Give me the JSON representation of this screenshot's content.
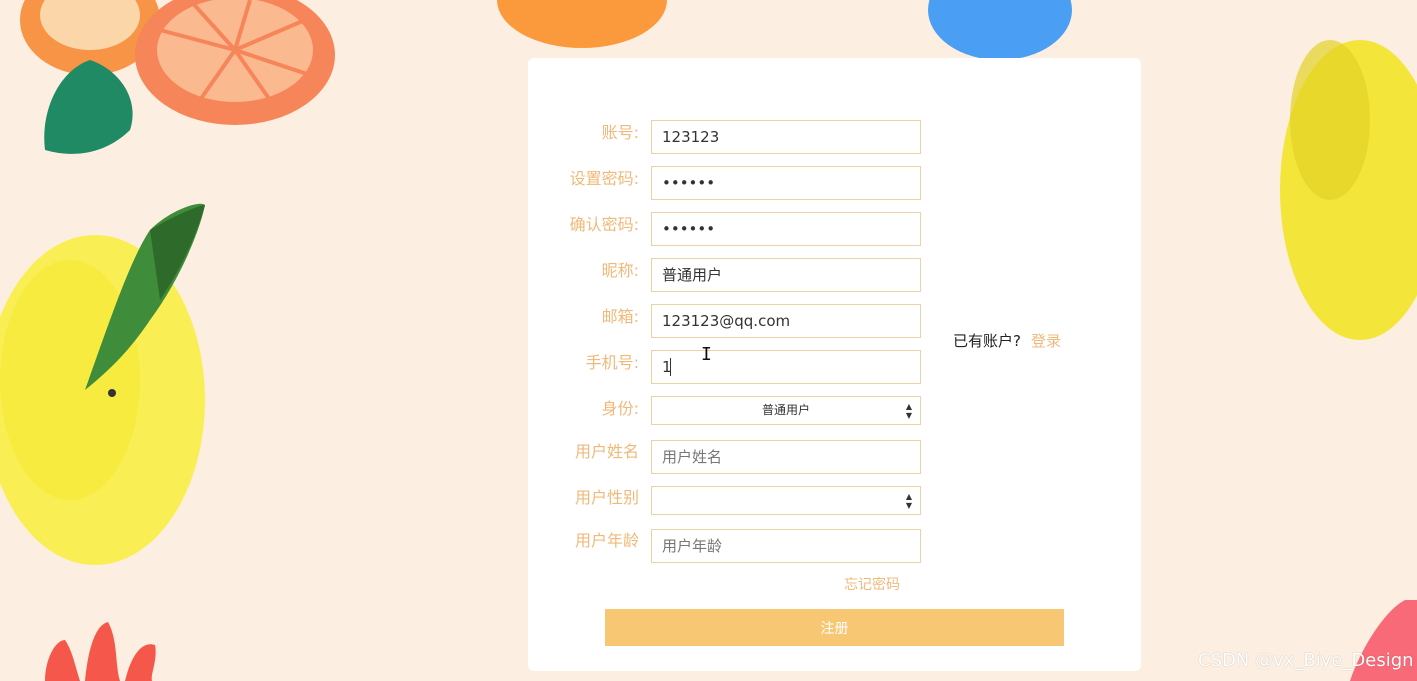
{
  "colors": {
    "background": "#fcefe1",
    "label": "#f0b97a",
    "field_border": "#ecd2a4",
    "button": "#f8c774"
  },
  "form": {
    "account": {
      "label": "账号:",
      "value": "123123"
    },
    "password": {
      "label": "设置密码:",
      "value": "••••••"
    },
    "confirm_password": {
      "label": "确认密码:",
      "value": "••••••"
    },
    "nickname": {
      "label": "昵称:",
      "value": "普通用户"
    },
    "email": {
      "label": "邮箱:",
      "value": "123123@qq.com"
    },
    "phone": {
      "label": "手机号:",
      "value": "1"
    },
    "identity": {
      "label": "身份:",
      "selected": "普通用户"
    },
    "real_name": {
      "label": "用户姓名",
      "placeholder": "用户姓名"
    },
    "gender": {
      "label": "用户性别",
      "selected": ""
    },
    "age": {
      "label": "用户年龄",
      "placeholder": "用户年龄"
    },
    "forgot_password": "忘记密码",
    "submit_label": "注册"
  },
  "login_hint": {
    "text": "已有账户?",
    "link": "登录"
  },
  "watermark": "CSDN @vx_Biye_Design",
  "icons": {
    "select_arrows": "updown-arrows-icon",
    "cursor": "text-cursor-icon"
  }
}
